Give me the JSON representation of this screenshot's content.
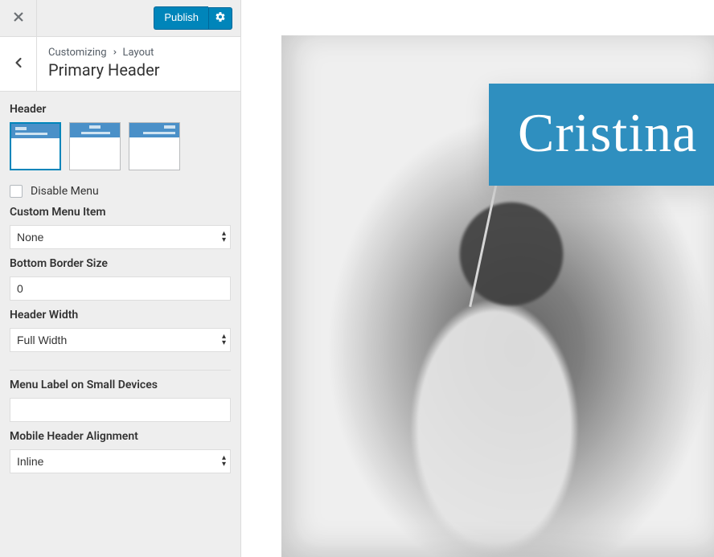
{
  "topbar": {
    "publish_label": "Publish"
  },
  "breadcrumb": {
    "root": "Customizing",
    "section": "Layout"
  },
  "section_title": "Primary Header",
  "controls": {
    "header_label": "Header",
    "disable_menu_label": "Disable Menu",
    "custom_menu_item_label": "Custom Menu Item",
    "custom_menu_item_value": "None",
    "bottom_border_label": "Bottom Border Size",
    "bottom_border_value": "0",
    "header_width_label": "Header Width",
    "header_width_value": "Full Width",
    "menu_label_small_label": "Menu Label on Small Devices",
    "menu_label_small_value": "",
    "mobile_align_label": "Mobile Header Alignment",
    "mobile_align_value": "Inline"
  },
  "preview": {
    "hero_title": "Cristina"
  }
}
